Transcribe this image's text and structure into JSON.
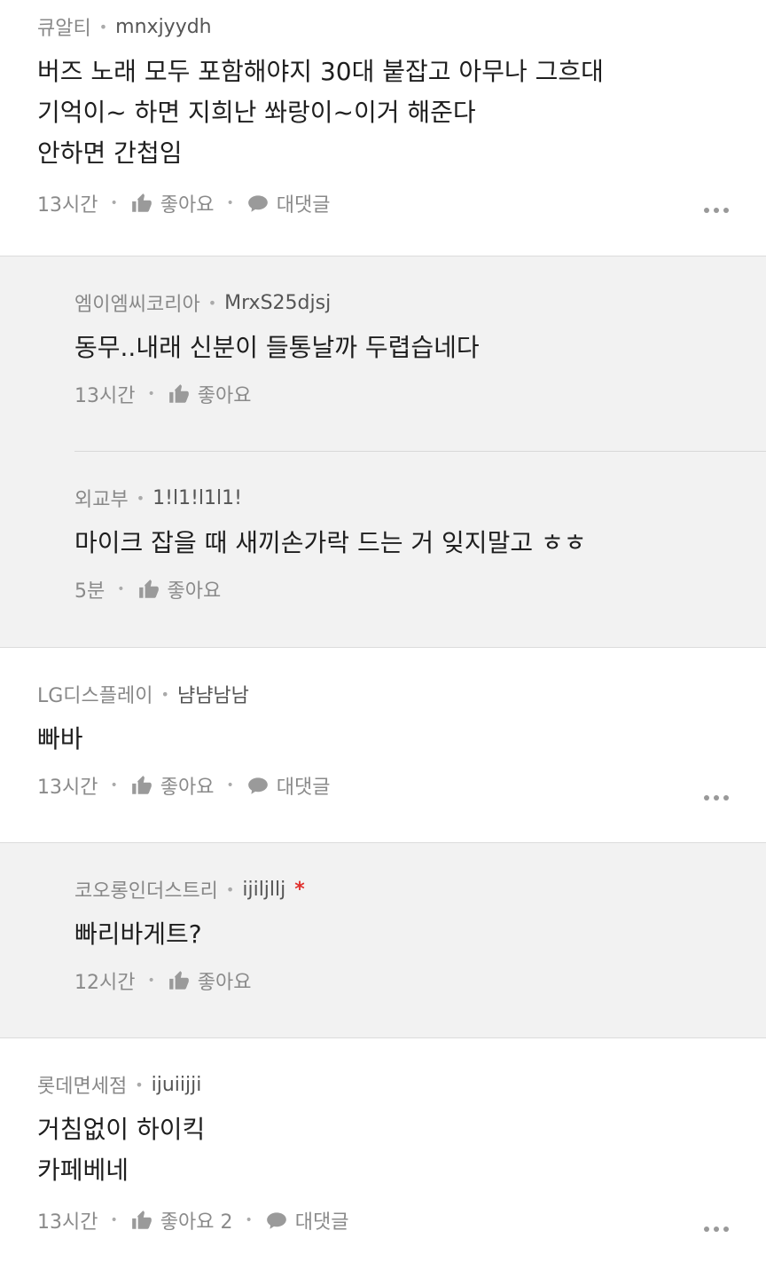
{
  "comments": [
    {
      "nickname": "큐알티",
      "user_id": "mnxjyydh",
      "lines": [
        "버즈 노래 모두 포함해야지 30대 붙잡고 아무나 그흐대",
        "기억이~ 하면 지희난 쏴랑이~이거 해준다",
        "안하면 간첩임"
      ],
      "time": "13시간",
      "like_label": "좋아요",
      "reply_label": "대댓글"
    },
    {
      "replies": [
        {
          "nickname": "엠이엠씨코리아",
          "user_id": "MrxS25djsj",
          "text": "동무..내래 신분이 들통날까 두렵습네다",
          "time": "13시간",
          "like_label": "좋아요"
        },
        {
          "nickname": "외교부",
          "user_id": "1!l1!l1l1!",
          "text": "마이크 잡을 때 새끼손가락 드는 거 잊지말고 ㅎㅎ",
          "time": "5분",
          "like_label": "좋아요"
        }
      ]
    },
    {
      "nickname": "LG디스플레이",
      "user_id": "냠냠남남",
      "lines": [
        "빠바"
      ],
      "time": "13시간",
      "like_label": "좋아요",
      "reply_label": "대댓글"
    },
    {
      "replies": [
        {
          "nickname": "코오롱인더스트리",
          "user_id": "ijiljllj",
          "star": "*",
          "text": "빠리바게트?",
          "time": "12시간",
          "like_label": "좋아요"
        }
      ]
    },
    {
      "nickname": "롯데면세점",
      "user_id": "ijuiijji",
      "lines": [
        "거침없이 하이킥",
        "카페베네"
      ],
      "time": "13시간",
      "like_label": "좋아요 2",
      "reply_label": "대댓글"
    }
  ],
  "icons": {
    "like": "thumbs-up-icon",
    "reply": "speech-bubble-icon",
    "more": "more-dots-icon"
  },
  "colors": {
    "meta_text": "#888888",
    "body_text": "#1e1e1e",
    "reply_background": "#f2f2f2",
    "badge_star": "#e0312e"
  }
}
